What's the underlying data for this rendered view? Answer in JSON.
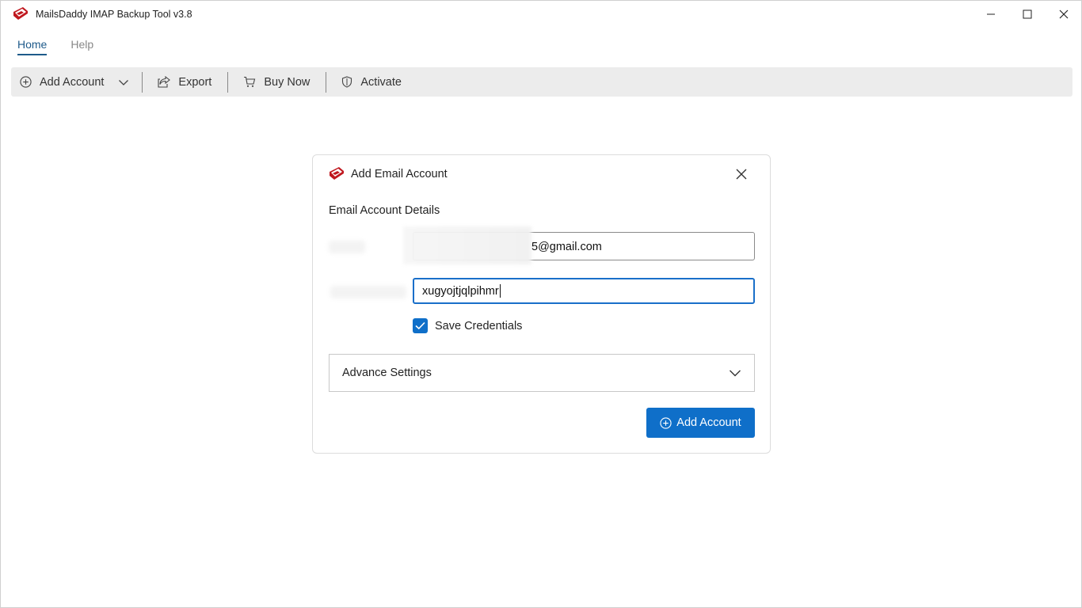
{
  "window": {
    "title": "MailsDaddy IMAP Backup Tool v3.8",
    "controls": [
      "minimize",
      "maximize",
      "close"
    ]
  },
  "menu": {
    "tabs": [
      {
        "label": "Home",
        "active": true
      },
      {
        "label": "Help",
        "active": false
      }
    ]
  },
  "toolbar": {
    "add_account": "Add Account",
    "export": "Export",
    "buy_now": "Buy Now",
    "activate": "Activate"
  },
  "dialog": {
    "title": "Add Email Account",
    "section_title": "Email Account Details",
    "email": {
      "visible_suffix": "5@gmail.com",
      "masked": true
    },
    "password": {
      "value": "xugyojtjqlpihmr",
      "focused": true
    },
    "save_credentials": {
      "label": "Save Credentials",
      "checked": true
    },
    "advance_settings": {
      "label": "Advance Settings",
      "expanded": false
    },
    "submit_label": "Add Account"
  },
  "colors": {
    "accent": "#0f6fc9",
    "toolbar_bg": "#ececec",
    "active_tab": "#1e5a8a"
  },
  "icons": {
    "app_logo": "mailsdaddy-logo",
    "add": "plus-circle-icon",
    "export": "export-icon",
    "cart": "cart-icon",
    "shield": "shield-icon",
    "chevron": "chevron-down-icon",
    "close": "close-icon",
    "check": "check-icon"
  }
}
